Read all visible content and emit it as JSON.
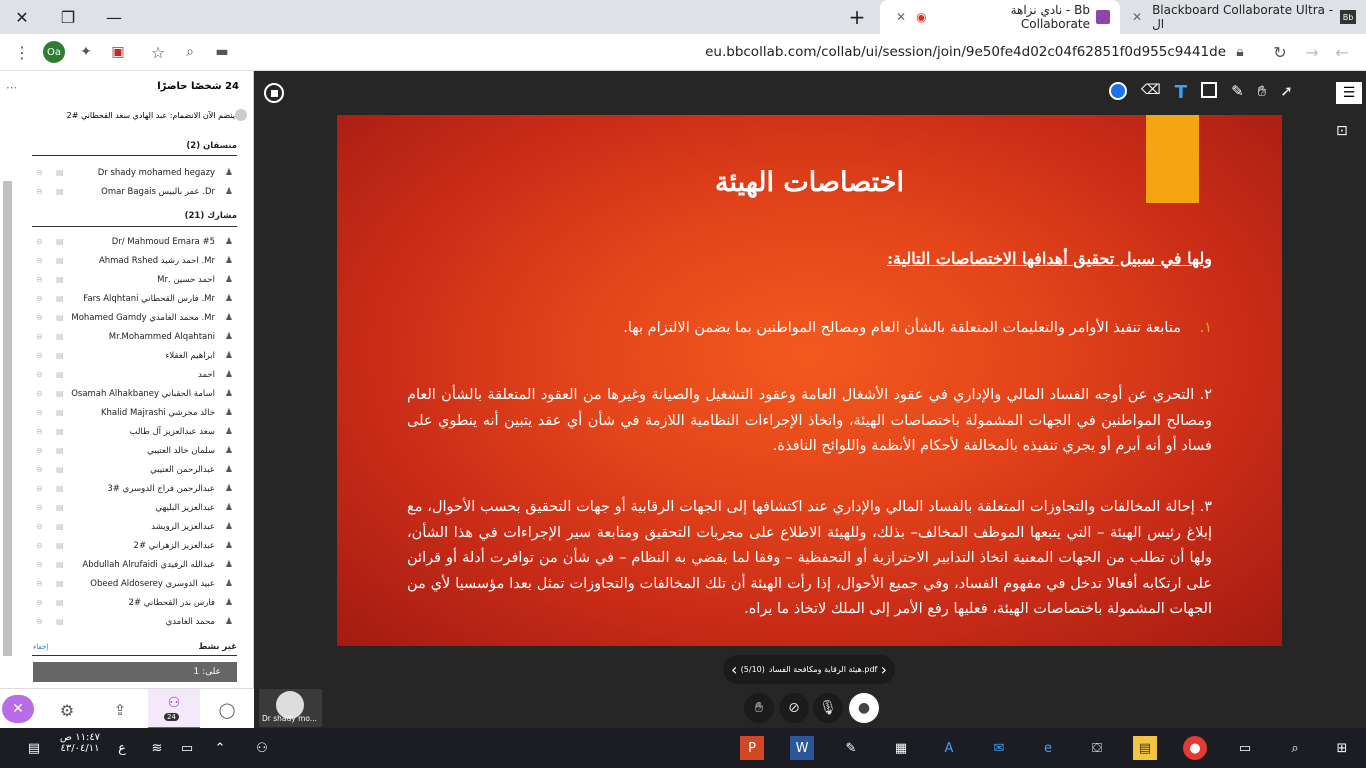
{
  "browser": {
    "tabs": [
      {
        "title": "نادي نزاهة - Bb Collaborate",
        "active": true
      },
      {
        "title": "Blackboard Collaborate Ultra - ال",
        "active": false
      }
    ],
    "url": "eu.bbcollab.com/collab/ui/session/join/9e50fe4d02c04f62851f0d955c9441de",
    "profile": "Oa",
    "new_tab": "+"
  },
  "panel": {
    "attendee_count": "24 شخصًا حاضرًا",
    "joined_label": "ينضم الآن الانضمام: عبد الهادي سعد القحطاني #2",
    "moderators_header": "منسقان (2)",
    "moderators": [
      "Dr shady mohamed hegazy",
      "Dr. عمر بالبيس Omar Bagais"
    ],
    "participants_header": "مشارك (21)",
    "participants": [
      "Dr/ Mahmoud Emara #5",
      "Mr. احمد رشيد Ahmad Rshed",
      "احمد حسين .Mr",
      "Mr. فارس القحطاني Fars Alqhtani",
      "Mr. محمد الغامدي Mohamed Gamdy",
      "Mr.Mohammed Alqahtani",
      "ابراهيم العقلاء",
      "احمد",
      "اسامة الحقباني Osamah Alhakbaney",
      "خالد مجرشي Khalid Majrashi",
      "سعد عبدالعزيز آل طالب",
      "سلمان خالد العتيبي",
      "عبدالرحمن العتيبي",
      "عبدالرحمن فراج الدوسري #3",
      "عبدالعزيز البليهي",
      "عبدالعزيز الرويشد",
      "عبدالعزيز الزهراني #2",
      "عبدالله الرفيدي Abdullah Alrufaidi",
      "عبيد الدوسري Obeed Aldoserey",
      "فارس بدر القحطاني #2",
      "محمد الغامدي"
    ],
    "away_header": "غير نشط",
    "away_link": "إخفاء",
    "away_row": "على: 1",
    "badge": "24"
  },
  "slide": {
    "title": "اختصاصات الهيئة",
    "subtitle": "ولها في سبيل تحقيق أهدافها الاختصاصات التالية:",
    "item1_num": "١.",
    "item1": "متابعة تنفيذ الأوامر والتعليمات المتعلقة بالشأن العام ومصالح المواطنين بما يضمن الالتزام بها.",
    "item2": "٢. التحري عن أوجه الفساد المالي والإداري في عقود الأشغال العامة وعقود التشغيل والصيانة وغيرها من العقود المتعلقة بالشأن العام ومصالح المواطنين في الجهات المشمولة باختصاصات الهيئة، واتخاذ الإجراءات النظامية اللازمة في شأن أي عقد يتبين أنه ينطوي على فساد أو أنه أبرم أو يجري تنفيذه بالمخالفة لأحكام الأنظمة واللوائح النافذة.",
    "item3": "٣. إحالة المخالفات والتجاوزات المتعلقة بالفساد المالي والإداري عند اكتشافها إلى الجهات الرقابية أو جهات التحقيق بحسب الأحوال، مع إبلاغ رئيس الهيئة – التي يتبعها الموظف المخالف– بذلك، وللهيئة الاطلاع على مجريات التحقيق ومتابعة سير الإجراءات في هذا الشأن، ولها أن تطلب من الجهات المعنية اتخاذ التدابير الاحترازية أو التحفظية – وفقا لما يقضي به النظام – في شأن من توافرت أدلة أو قرائن على ارتكابه أفعالا تدخل في مفهوم الفساد، وفي جميع الأحوال، إذا رأت الهيئة أن تلك المخالفات والتجاوزات تمثل بعدا مؤسسيا لأي من الجهات المشمولة باختصاصات الهيئة، فعليها رفع الأمر إلى الملك لاتخاذ ما يراه."
  },
  "file_nav": {
    "file": "هيئة الرقابة ومكافحة الفساد.pdf",
    "page": "(5/10)"
  },
  "presenter": {
    "name": "Dr shady mo..."
  },
  "taskbar": {
    "time": "١١:٤٧ ص",
    "date": "٤٣/٠٤/١١",
    "lang": "ع"
  },
  "colors": {
    "accent": "#1a73e8",
    "slide_orange": "#f4a511",
    "selected_tab": "#8e44ad"
  }
}
